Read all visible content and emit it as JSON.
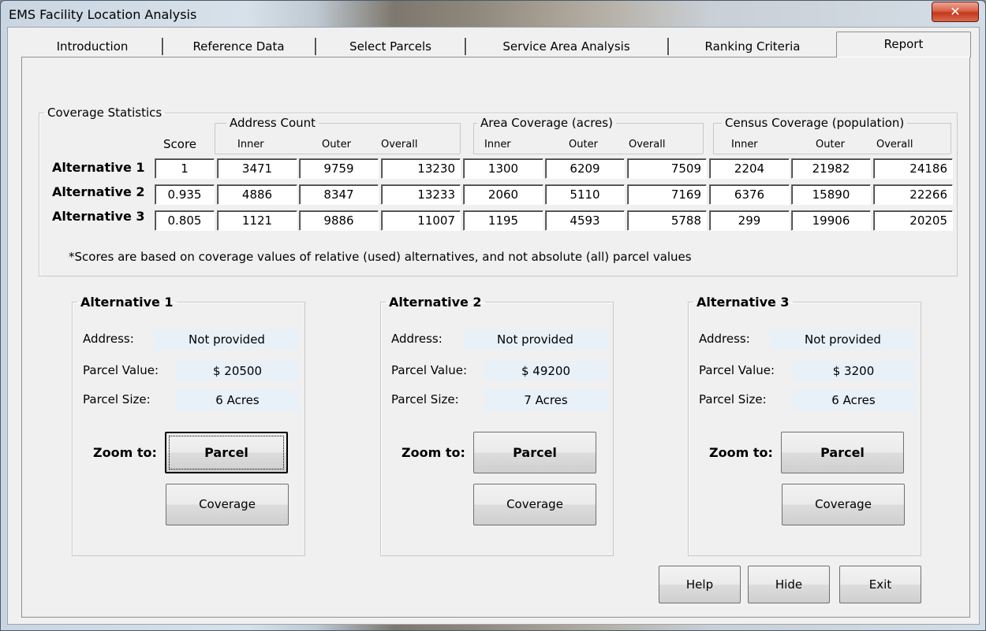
{
  "window": {
    "title": "EMS Facility Location Analysis",
    "close_glyph": "✕"
  },
  "tabs": [
    "Introduction",
    "Reference Data",
    "Select Parcels",
    "Service Area Analysis",
    "Ranking Criteria",
    "Report"
  ],
  "active_tab": "Report",
  "coverage": {
    "title": "Coverage Statistics",
    "score_header": "Score",
    "groups": [
      {
        "title": "Address Count",
        "cols": [
          "Inner",
          "Outer",
          "Overall"
        ]
      },
      {
        "title": "Area Coverage (acres)",
        "cols": [
          "Inner",
          "Outer",
          "Overall"
        ]
      },
      {
        "title": "Census Coverage (population)",
        "cols": [
          "Inner",
          "Outer",
          "Overall"
        ]
      }
    ],
    "rows": [
      {
        "label": "Alternative 1",
        "score": "1",
        "values": [
          "3471",
          "9759",
          "13230",
          "1300",
          "6209",
          "7509",
          "2204",
          "21982",
          "24186"
        ]
      },
      {
        "label": "Alternative 2",
        "score": "0.935",
        "values": [
          "4886",
          "8347",
          "13233",
          "2060",
          "5110",
          "7169",
          "6376",
          "15890",
          "22266"
        ]
      },
      {
        "label": "Alternative 3",
        "score": "0.805",
        "values": [
          "1121",
          "9886",
          "11007",
          "1195",
          "4593",
          "5788",
          "299",
          "19906",
          "20205"
        ]
      }
    ],
    "note": "*Scores are based on coverage values of relative (used) alternatives, and not absolute (all) parcel values"
  },
  "alternatives": [
    {
      "title": "Alternative 1",
      "address_label": "Address:",
      "address": "Not provided",
      "value_label": "Parcel Value:",
      "value": "$ 20500",
      "size_label": "Parcel Size:",
      "size": "6 Acres",
      "zoom_label": "Zoom to:",
      "parcel_btn": "Parcel",
      "coverage_btn": "Coverage"
    },
    {
      "title": "Alternative 2",
      "address_label": "Address:",
      "address": "Not provided",
      "value_label": "Parcel Value:",
      "value": "$ 49200",
      "size_label": "Parcel Size:",
      "size": "7 Acres",
      "zoom_label": "Zoom to:",
      "parcel_btn": "Parcel",
      "coverage_btn": "Coverage"
    },
    {
      "title": "Alternative 3",
      "address_label": "Address:",
      "address": "Not provided",
      "value_label": "Parcel Value:",
      "value": "$ 3200",
      "size_label": "Parcel Size:",
      "size": "6 Acres",
      "zoom_label": "Zoom to:",
      "parcel_btn": "Parcel",
      "coverage_btn": "Coverage"
    }
  ],
  "footer": {
    "help": "Help",
    "hide": "Hide",
    "exit": "Exit"
  }
}
